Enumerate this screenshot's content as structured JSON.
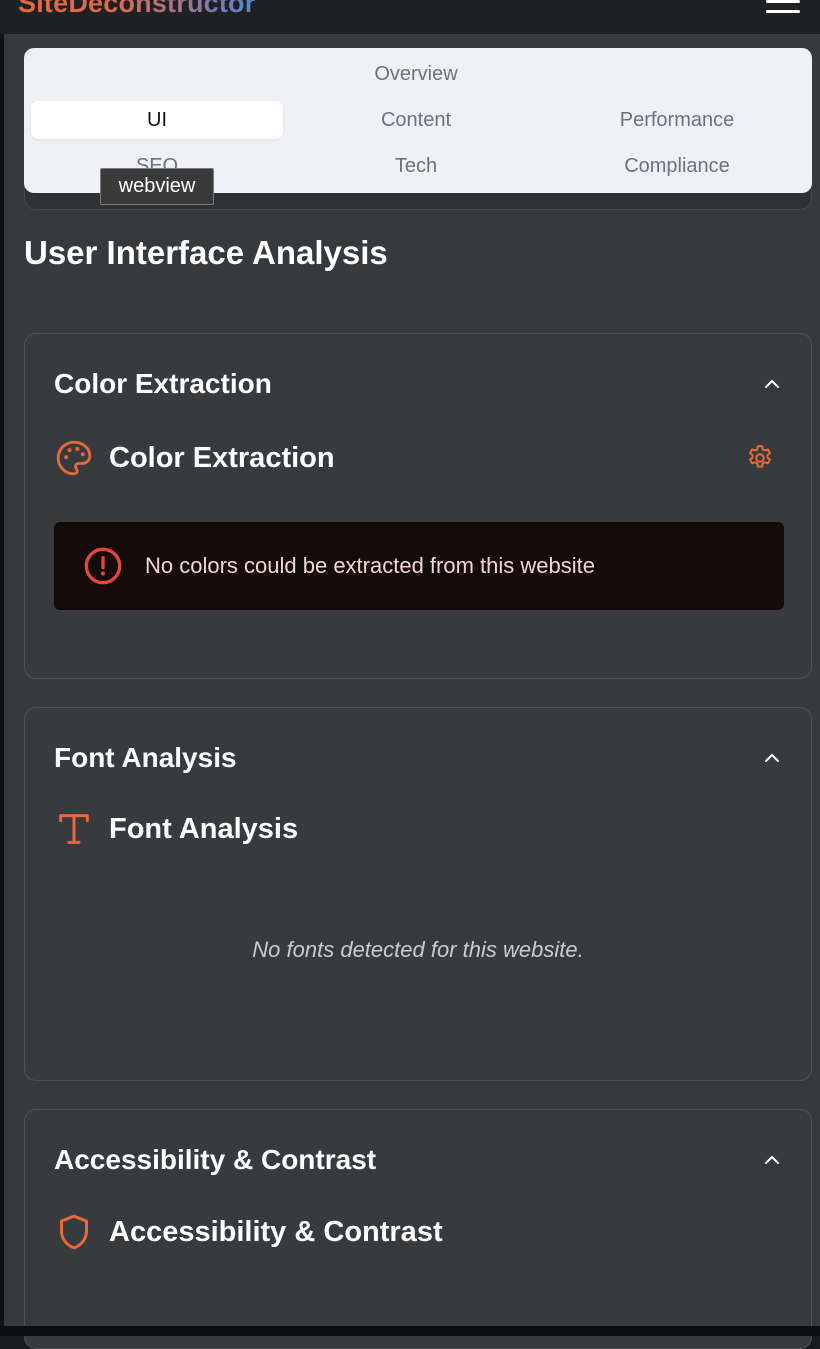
{
  "header": {
    "brand": "SiteDeconstructor",
    "menu_icon": "hamburger-menu-icon"
  },
  "tabs": [
    {
      "label": "Overview",
      "active": false
    },
    {
      "label": "UI",
      "active": true
    },
    {
      "label": "Content",
      "active": false
    },
    {
      "label": "Performance",
      "active": false
    },
    {
      "label": "SEO",
      "active": false
    },
    {
      "label": "Tech",
      "active": false
    },
    {
      "label": "Compliance",
      "active": false
    }
  ],
  "tooltip": "webview",
  "page_title": "User Interface Analysis",
  "sections": {
    "color": {
      "title": "Color Extraction",
      "sub_title": "Color Extraction",
      "icon": "palette-icon",
      "settings_icon": "gear-icon",
      "alert_icon": "alert-circle-icon",
      "alert_message": "No colors could be extracted from this website"
    },
    "font": {
      "title": "Font Analysis",
      "sub_title": "Font Analysis",
      "icon": "type-icon",
      "empty_message": "No fonts detected for this website."
    },
    "accessibility": {
      "title": "Accessibility & Contrast",
      "sub_title": "Accessibility & Contrast",
      "icon": "shield-icon"
    }
  },
  "colors": {
    "accent": "#e8693a",
    "alert_bg": "#150b0a",
    "alert_icon": "#e04a3a",
    "panel_bg": "#373b3e",
    "tabs_bg": "#eef1f6"
  }
}
